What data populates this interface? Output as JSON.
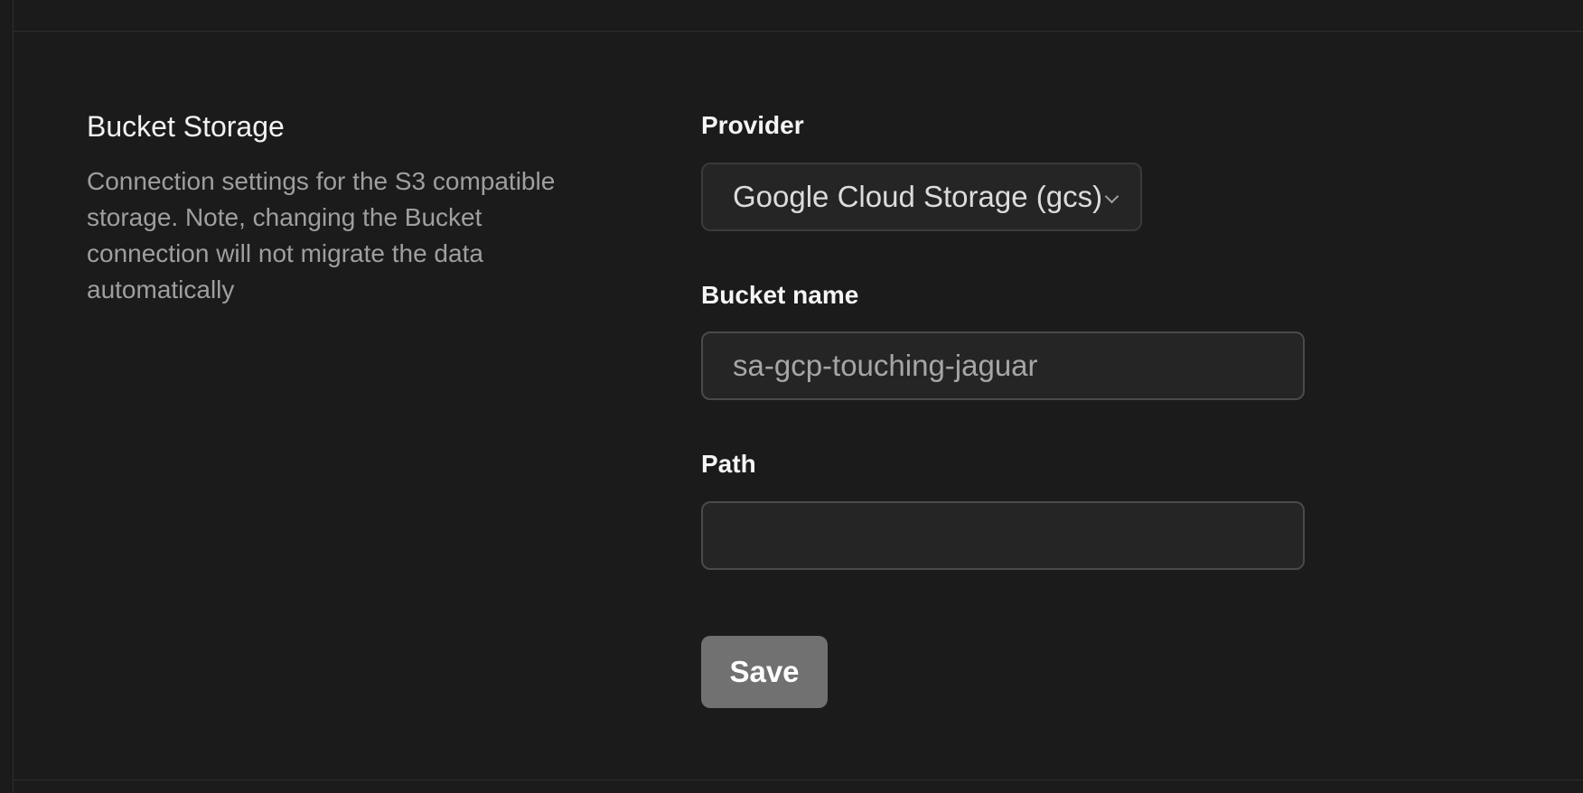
{
  "section": {
    "title": "Bucket Storage",
    "description": "Connection settings for the S3 compatible storage. Note, changing the Bucket connection will not migrate the data automatically"
  },
  "form": {
    "provider": {
      "label": "Provider",
      "selected": "Google Cloud Storage (gcs)",
      "icon": "chevron-down-icon"
    },
    "bucket_name": {
      "label": "Bucket name",
      "value": "sa-gcp-touching-jaguar"
    },
    "path": {
      "label": "Path",
      "value": ""
    },
    "save_label": "Save"
  },
  "colors": {
    "background": "#1b1b1b",
    "input_background": "#252525",
    "border": "#4a4a4a",
    "button": "#717171",
    "muted_text": "#9f9f9f"
  }
}
